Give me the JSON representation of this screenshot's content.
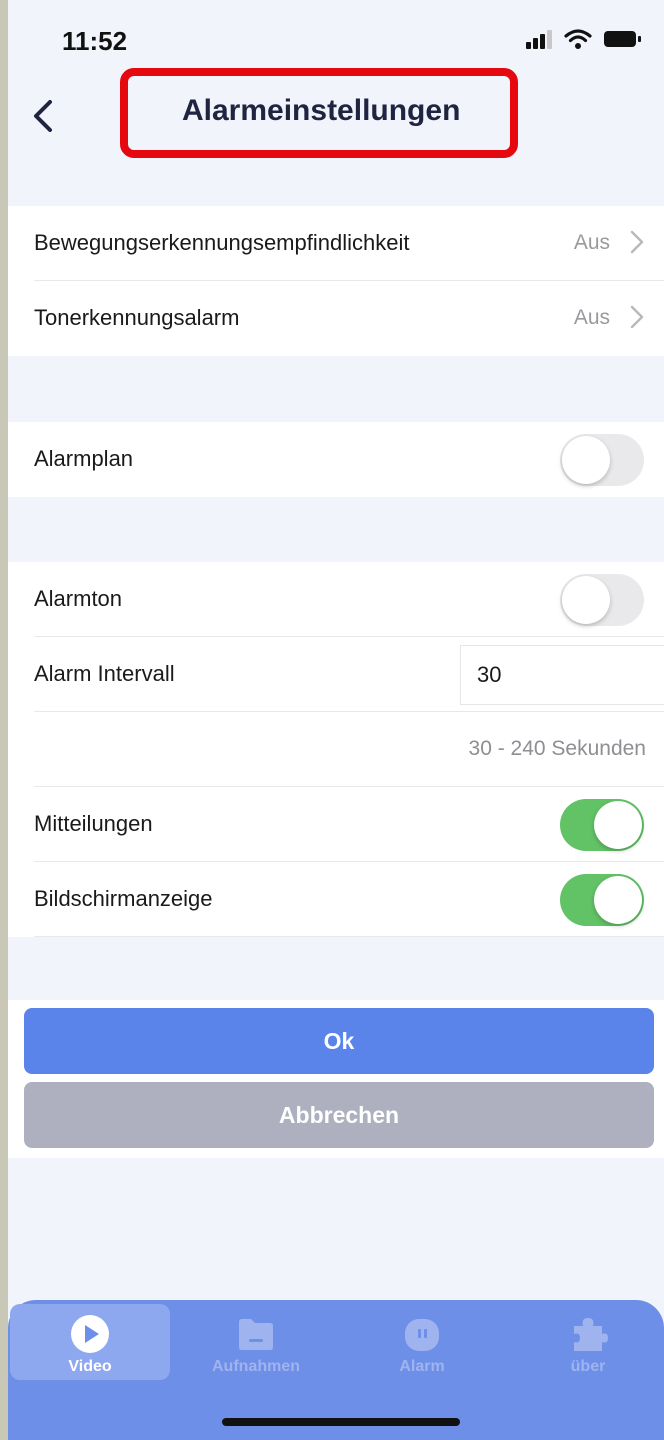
{
  "status": {
    "time": "11:52"
  },
  "header": {
    "title": "Alarmeinstellungen"
  },
  "detection": {
    "motion_label": "Bewegungserkennungsempfindlichkeit",
    "motion_value": "Aus",
    "sound_label": "Tonerkennungsalarm",
    "sound_value": "Aus"
  },
  "schedule": {
    "label": "Alarmplan",
    "enabled": false
  },
  "alarm": {
    "tone_label": "Alarmton",
    "tone_enabled": false,
    "interval_label": "Alarm Intervall",
    "interval_value": "30",
    "interval_hint": "30 - 240 Sekunden",
    "notify_label": "Mitteilungen",
    "notify_enabled": true,
    "display_label": "Bildschirmanzeige",
    "display_enabled": true
  },
  "buttons": {
    "ok": "Ok",
    "cancel": "Abbrechen"
  },
  "tabs": [
    {
      "label": "Video",
      "icon": "play-icon",
      "active": true
    },
    {
      "label": "Aufnahmen",
      "icon": "folder-icon",
      "active": false
    },
    {
      "label": "Alarm",
      "icon": "alarm-icon",
      "active": false
    },
    {
      "label": "über",
      "icon": "puzzle-icon",
      "active": false
    }
  ],
  "colors": {
    "accent": "#5b84ea",
    "toggle_on": "#62c266",
    "highlight": "#e5080f",
    "tabbar": "#6e8fe8"
  }
}
